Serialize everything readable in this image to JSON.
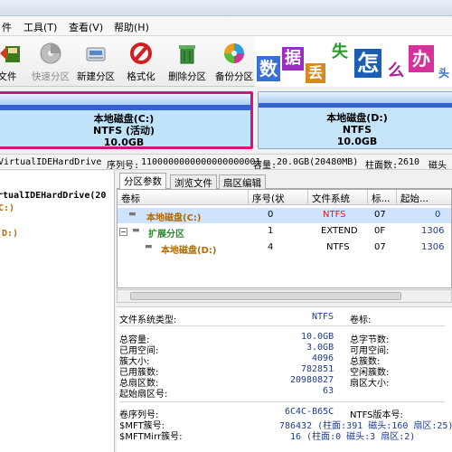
{
  "menu": {
    "items": [
      "件",
      "工具(T)",
      "查看(V)",
      "帮助(H)"
    ]
  },
  "toolbar": {
    "items": [
      {
        "label": "文件",
        "icon": "save-icon"
      },
      {
        "label": "快速分区",
        "icon": "quick-partition-icon"
      },
      {
        "label": "新建分区",
        "icon": "new-partition-icon"
      },
      {
        "label": "格式化",
        "icon": "format-icon"
      },
      {
        "label": "删除分区",
        "icon": "delete-partition-icon"
      },
      {
        "label": "备份分区",
        "icon": "backup-partition-icon"
      }
    ]
  },
  "banner": {
    "chars": [
      "数",
      "据",
      "丢",
      "失",
      "怎",
      "么",
      "办"
    ],
    "extra": "头"
  },
  "diskmap": {
    "partitions": [
      {
        "name": "本地磁盘(C:)",
        "fs": "NTFS (活动)",
        "size": "10.0GB"
      },
      {
        "name": "本地磁盘(D:)",
        "fs": "NTFS",
        "size": "10.0GB"
      }
    ]
  },
  "disk_info": {
    "model": "VirtualIDEHardDrive",
    "serial_label": "序列号:",
    "serial": "1100000000000000000001",
    "capacity_label": "容量:",
    "capacity": "20.0GB(20480MB)",
    "cylinders_label": "柱面数:",
    "cylinders": "2610",
    "heads_label": "磁头"
  },
  "tree": {
    "disk": "rtualIDEHardDrive(20",
    "c_part": "C:)",
    "d_part": "(D:)"
  },
  "tabs": [
    "分区参数",
    "浏览文件",
    "扇区编辑"
  ],
  "grid": {
    "headers": [
      "卷标",
      "序号(状",
      "文件系统",
      "标...",
      "起始..."
    ],
    "rows": [
      {
        "label": "本地磁盘(C:)",
        "index": "0",
        "fs": "NTFS",
        "id": "07",
        "start": "0"
      },
      {
        "label": "扩展分区",
        "index": "1",
        "fs": "EXTEND",
        "id": "0F",
        "start": "1306"
      },
      {
        "label": "本地磁盘(D:)",
        "index": "4",
        "fs": "NTFS",
        "id": "07",
        "start": "1306"
      }
    ]
  },
  "details": {
    "fs_type_label": "文件系统类型:",
    "fs_type": "NTFS",
    "volume_label": "卷标:",
    "total_label": "总容量:",
    "total": "10.0GB",
    "total_bytes_label": "总字节数:",
    "used_label": "已用空间:",
    "used": "3.0GB",
    "free_label": "可用空间:",
    "cluster_size_label": "簇大小:",
    "cluster_size": "4096",
    "total_clusters_label": "总簇数:",
    "used_clusters_label": "已用簇数:",
    "used_clusters": "782851",
    "free_clusters_label": "空闲簇数:",
    "total_sectors_label": "总扇区数:",
    "total_sectors": "20980827",
    "sector_size_label": "扇区大小:",
    "start_sector_label": "起始扇区号:",
    "start_sector": "63",
    "volume_serial_label": "卷序列号:",
    "volume_serial": "6C4C-B65C",
    "ntfs_version_label": "NTFS版本号:",
    "mft_label": "$MFT簇号:",
    "mft": "786432 (柱面:391 磁头:160 扇区:25)",
    "mftmirr_label": "$MFTMirr簇号:",
    "mftmirr": "16 (柱面:0 磁头:3 扇区:2)"
  },
  "colors": {
    "partition_c": "#d4147a",
    "partition_d": "#2c64c8",
    "selected_row": "#cfe3ff",
    "value_text": "#1f3c8c"
  }
}
